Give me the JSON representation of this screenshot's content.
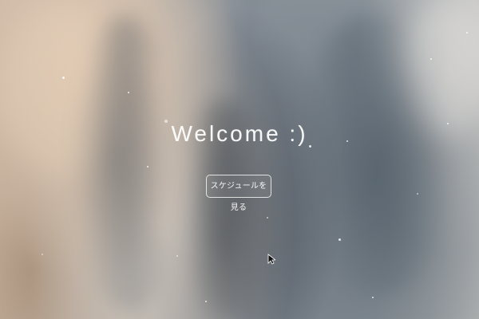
{
  "hero": {
    "title": "Welcome :)",
    "button_label": "スケジュールを見る"
  },
  "colors": {
    "text": "#ffffff",
    "button_border": "#ffffff"
  },
  "icons": {
    "cursor": "mouse-pointer-icon"
  }
}
